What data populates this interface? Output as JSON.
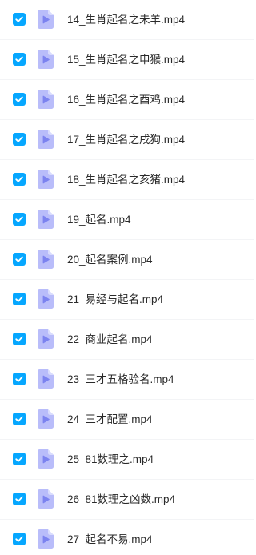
{
  "colors": {
    "checkbox": "#06a7ff",
    "video_icon_page": "#b9bdfa",
    "video_icon_fold": "#d9dcfd",
    "video_icon_play": "#7c83f0"
  },
  "file_list": {
    "items": [
      {
        "name": "14_生肖起名之未羊.mp4",
        "checked": true,
        "icon": "video-file-icon"
      },
      {
        "name": "15_生肖起名之申猴.mp4",
        "checked": true,
        "icon": "video-file-icon"
      },
      {
        "name": "16_生肖起名之酉鸡.mp4",
        "checked": true,
        "icon": "video-file-icon"
      },
      {
        "name": "17_生肖起名之戌狗.mp4",
        "checked": true,
        "icon": "video-file-icon"
      },
      {
        "name": "18_生肖起名之亥猪.mp4",
        "checked": true,
        "icon": "video-file-icon"
      },
      {
        "name": "19_起名.mp4",
        "checked": true,
        "icon": "video-file-icon"
      },
      {
        "name": "20_起名案例.mp4",
        "checked": true,
        "icon": "video-file-icon"
      },
      {
        "name": "21_易经与起名.mp4",
        "checked": true,
        "icon": "video-file-icon"
      },
      {
        "name": "22_商业起名.mp4",
        "checked": true,
        "icon": "video-file-icon"
      },
      {
        "name": "23_三才五格验名.mp4",
        "checked": true,
        "icon": "video-file-icon"
      },
      {
        "name": "24_三才配置.mp4",
        "checked": true,
        "icon": "video-file-icon"
      },
      {
        "name": "25_81数理之.mp4",
        "checked": true,
        "icon": "video-file-icon"
      },
      {
        "name": "26_81数理之凶数.mp4",
        "checked": true,
        "icon": "video-file-icon"
      },
      {
        "name": "27_起名不易.mp4",
        "checked": true,
        "icon": "video-file-icon"
      }
    ]
  }
}
